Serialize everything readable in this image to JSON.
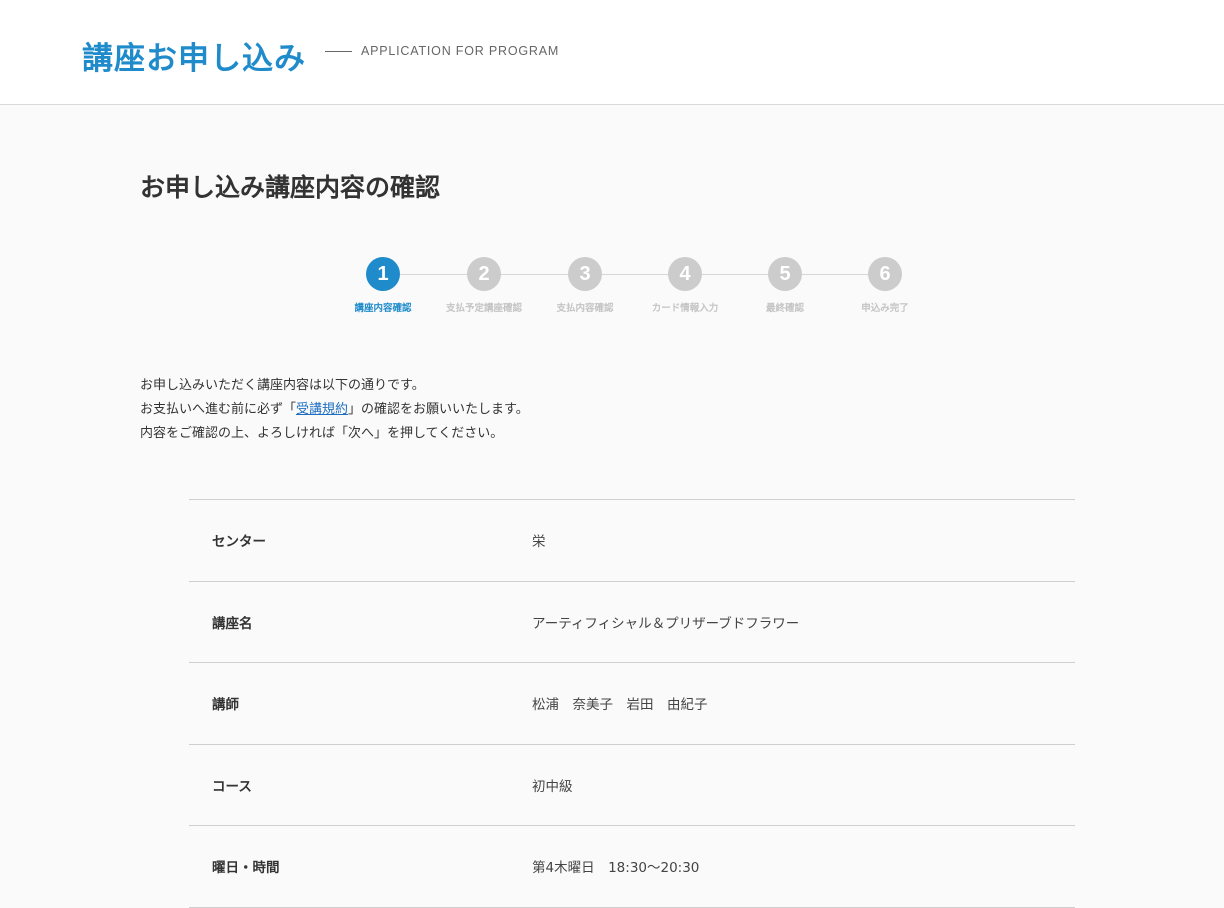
{
  "header": {
    "title": "講座お申し込み",
    "subtitle": "APPLICATION FOR PROGRAM"
  },
  "page": {
    "title": "お申し込み講座内容の確認"
  },
  "steps": [
    {
      "number": "1",
      "label": "講座内容確認",
      "active": true
    },
    {
      "number": "2",
      "label": "支払予定講座確認",
      "active": false
    },
    {
      "number": "3",
      "label": "支払内容確認",
      "active": false
    },
    {
      "number": "4",
      "label": "カード情報入力",
      "active": false
    },
    {
      "number": "5",
      "label": "最終確認",
      "active": false
    },
    {
      "number": "6",
      "label": "申込み完了",
      "active": false
    }
  ],
  "intro": {
    "line1": "お申し込みいただく講座内容は以下の通りです。",
    "line2_before": "お支払いへ進む前に必ず「",
    "line2_link": "受講規約",
    "line2_after": "」の確認をお願いいたします。",
    "line3": "内容をご確認の上、よろしければ「次へ」を押してください。"
  },
  "details": {
    "rows": [
      {
        "label": "センター",
        "value": "栄"
      },
      {
        "label": "講座名",
        "value": "アーティフィシャル＆プリザーブドフラワー"
      },
      {
        "label": "講師",
        "value": "松浦　奈美子　岩田　由紀子"
      },
      {
        "label": "コース",
        "value": "初中級"
      },
      {
        "label": "曜日・時間",
        "value": "第4木曜日　18:30〜20:30"
      }
    ]
  },
  "colors": {
    "accent": "#1f8bcb",
    "inactive_step": "#cccccc",
    "link": "#1f6fc0"
  }
}
